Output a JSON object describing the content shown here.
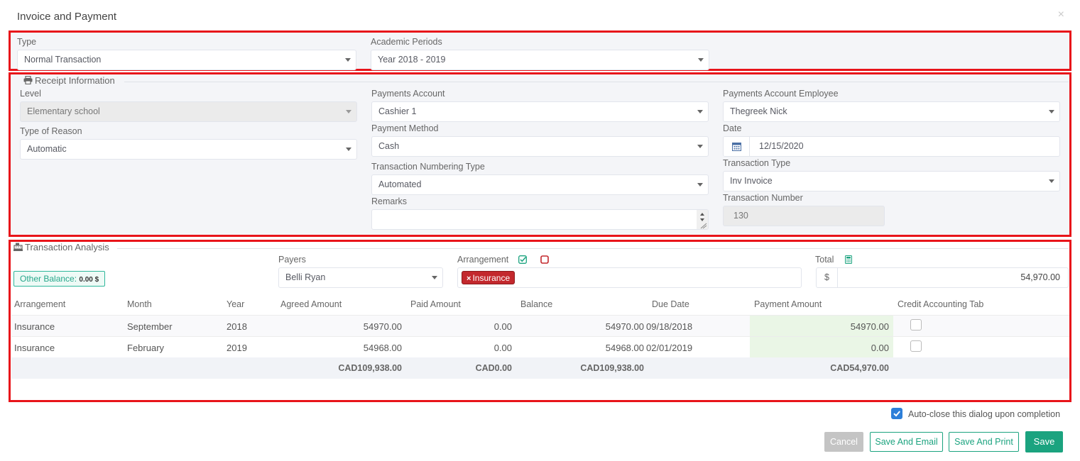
{
  "modal": {
    "title": "Invoice and Payment",
    "close": "×"
  },
  "type_section": {
    "type_label": "Type",
    "type_value": "Normal Transaction",
    "periods_label": "Academic Periods",
    "periods_value": "Year 2018 - 2019"
  },
  "receipt": {
    "legend": "Receipt Information",
    "level_label": "Level",
    "level_value": "Elementary school",
    "reason_label": "Type of Reason",
    "reason_value": "Automatic",
    "account_label": "Payments Account",
    "account_value": "Cashier 1",
    "method_label": "Payment Method",
    "method_value": "Cash",
    "numbering_label": "Transaction Numbering Type",
    "numbering_value": "Automated",
    "remarks_label": "Remarks",
    "remarks_value": "",
    "employee_label": "Payments Account Employee",
    "employee_value": "Thegreek Nick",
    "date_label": "Date",
    "date_value": "12/15/2020",
    "trans_type_label": "Transaction Type",
    "trans_type_value": "Inv Invoice",
    "trans_number_label": "Transaction Number",
    "trans_number_value": "130"
  },
  "analysis": {
    "legend": "Transaction Analysis",
    "other_balance_label": "Other Balance:",
    "other_balance_value": "0.00 $",
    "payers_label": "Payers",
    "payers_value": "Belli Ryan",
    "arrangement_label": "Arrangement",
    "arrangement_tag": "Insurance",
    "total_label": "Total",
    "total_currency": "$",
    "total_value": "54,970.00"
  },
  "table": {
    "headers": [
      "Arrangement",
      "Month",
      "Year",
      "Agreed Amount",
      "Paid Amount",
      "Balance",
      "Due Date",
      "Payment Amount",
      "Credit Accounting Tab"
    ],
    "rows": [
      [
        "Insurance",
        "September",
        "2018",
        "54970.00",
        "0.00",
        "54970.00",
        "09/18/2018",
        "54970.00"
      ],
      [
        "Insurance",
        "February",
        "2019",
        "54968.00",
        "0.00",
        "54968.00",
        "02/01/2019",
        "0.00"
      ]
    ],
    "totals": {
      "agreed": "CAD109,938.00",
      "paid": "CAD0.00",
      "balance": "CAD109,938.00",
      "payment": "CAD54,970.00"
    }
  },
  "footer": {
    "autoclose_label": "Auto-close this dialog upon completion",
    "cancel": "Cancel",
    "save_email": "Save And Email",
    "save_print": "Save And Print",
    "save": "Save"
  },
  "colors": {
    "accent": "#1ba37f",
    "highlight_border": "#e8141a",
    "tag": "#c3282d",
    "checkbox": "#2d7fd9"
  }
}
